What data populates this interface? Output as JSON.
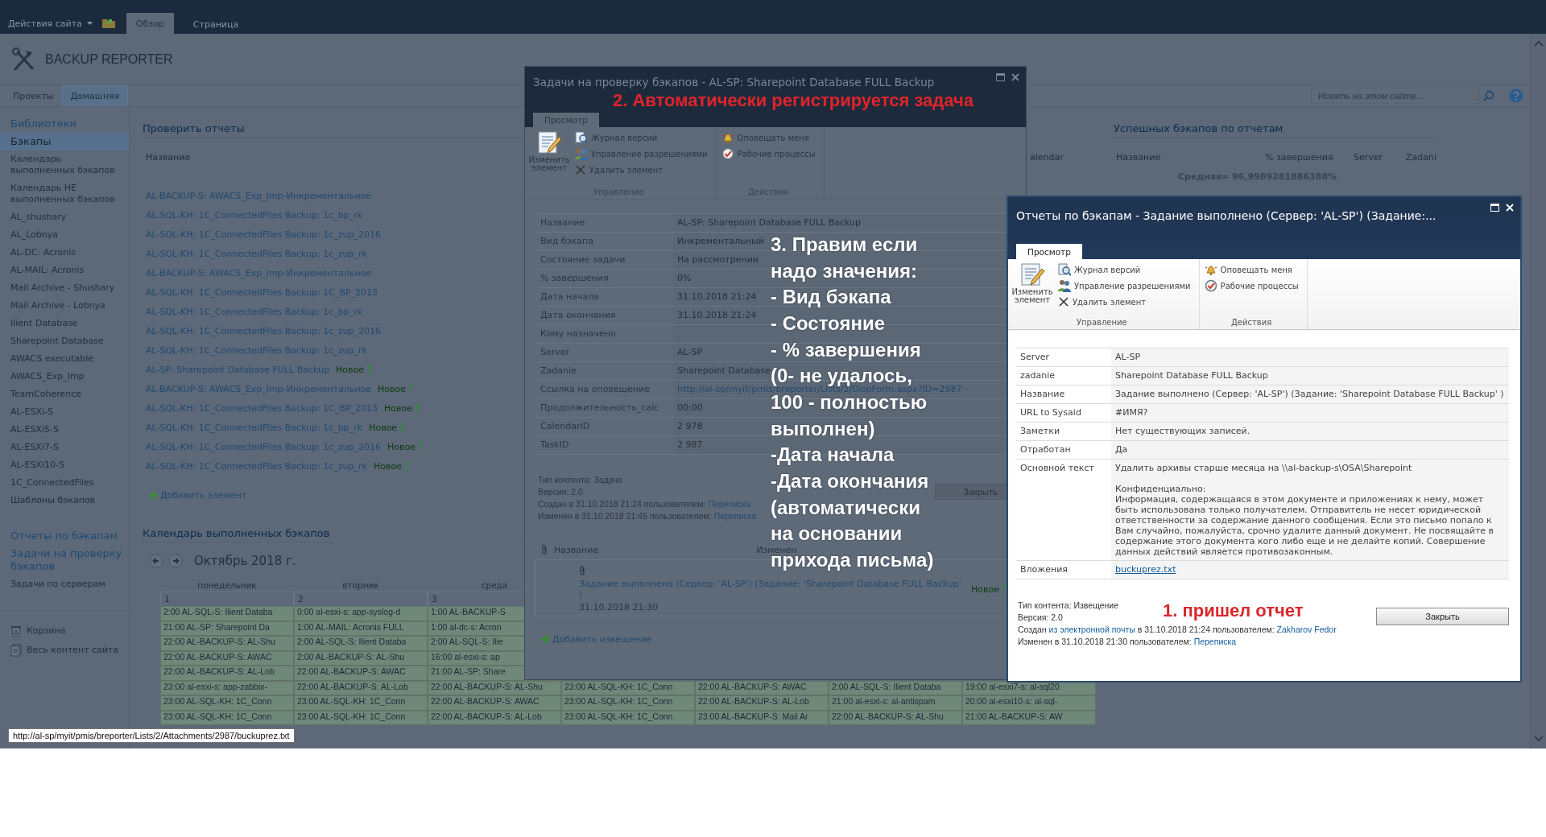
{
  "top_bar": {
    "site_actions": "Действия сайта",
    "tabs": [
      {
        "label": "Обзор",
        "selected": true
      },
      {
        "label": "Страница",
        "selected": false
      }
    ]
  },
  "site": {
    "title": "BACKUP REPORTER"
  },
  "nav": {
    "tabs": [
      {
        "label": "Проекты",
        "selected": false
      },
      {
        "label": "Домашняя",
        "selected": true
      }
    ],
    "search": {
      "placeholder": "Искать на этом сайте..."
    }
  },
  "sidebar": {
    "groups": [
      {
        "items": [
          {
            "label": "Библиотеки",
            "kind": "heading",
            "selected": false
          },
          {
            "label": "Бэкапы",
            "kind": "heading",
            "selected": true
          },
          {
            "label": "Календарь выполненных бэкапов",
            "kind": "link",
            "selected": false
          },
          {
            "label": "Календарь НЕ выполненных бэкапов",
            "kind": "link",
            "selected": false
          },
          {
            "label": "AL_shushary",
            "kind": "link",
            "selected": false
          },
          {
            "label": "AL_Lobnya",
            "kind": "link",
            "selected": false
          },
          {
            "label": "AL-DC: Acronis",
            "kind": "link",
            "selected": false
          },
          {
            "label": "AL-MAIL: Acronis",
            "kind": "link",
            "selected": false
          },
          {
            "label": "Mail Archive - Shushary",
            "kind": "link",
            "selected": false
          },
          {
            "label": "Mail Archive - Lobnya",
            "kind": "link",
            "selected": false
          },
          {
            "label": "Ilient Database",
            "kind": "link",
            "selected": false
          },
          {
            "label": "Sharepoint Database",
            "kind": "link",
            "selected": false
          },
          {
            "label": "AWACS executable",
            "kind": "link",
            "selected": false
          },
          {
            "label": "AWACS_Exp_Imp",
            "kind": "link",
            "selected": false
          },
          {
            "label": "TeamCoherence",
            "kind": "link",
            "selected": false
          },
          {
            "label": "AL-ESXi-S",
            "kind": "link",
            "selected": false
          },
          {
            "label": "AL-ESXi5-S",
            "kind": "link",
            "selected": false
          },
          {
            "label": "AL-ESXi7-S",
            "kind": "link",
            "selected": false
          },
          {
            "label": "AL-ESXi10-S",
            "kind": "link",
            "selected": false
          },
          {
            "label": "1C_ConnectedFiles",
            "kind": "link",
            "selected": false
          },
          {
            "label": "Шаблоны бэкапов",
            "kind": "link",
            "selected": false
          }
        ]
      },
      {
        "items": [
          {
            "label": "Отчеты по бэкапам",
            "kind": "heading",
            "selected": false
          },
          {
            "label": "Задачи на проверку бэкапов",
            "kind": "heading",
            "selected": false
          },
          {
            "label": "Задачи по серверам",
            "kind": "link",
            "selected": false
          }
        ]
      },
      {
        "items": [
          {
            "label": "Корзина",
            "kind": "trash",
            "selected": false
          },
          {
            "label": "Весь контент сайта",
            "kind": "pages",
            "selected": false
          }
        ]
      }
    ]
  },
  "check_reports": {
    "title": "Проверить отчеты",
    "column": "Название",
    "rows": [
      {
        "text": "AL-BACKUP-S: AWACS_Exp_Imp-Инкрементальное"
      },
      {
        "text": "AL-SQL-KH: 1C_ConnectedFiles Backup: 1c_bp_rk"
      },
      {
        "text": "AL-SQL-KH: 1C_ConnectedFiles Backup: 1c_zup_2016"
      },
      {
        "text": "AL-SQL-KH: 1C_ConnectedFiles Backup: 1c_zup_rk"
      },
      {
        "text": "AL-BACKUP-S: AWACS_Exp_Imp-Инкрементальное"
      },
      {
        "text": "AL-SQL-KH: 1C_ConnectedFiles Backup: 1C_BP_2013"
      },
      {
        "text": "AL-SQL-KH: 1C_ConnectedFiles Backup: 1c_bp_rk"
      },
      {
        "text": "AL-SQL-KH: 1C_ConnectedFiles Backup: 1c_zup_2016"
      },
      {
        "text": "AL-SQL-KH: 1C_ConnectedFiles Backup: 1c_zup_rk"
      },
      {
        "text": "AL-SP: Sharepoint Database FULL Backup",
        "badge": "Новое"
      },
      {
        "text": "AL-BACKUP-S: AWACS_Exp_Imp-Инкрементальное",
        "badge": "Новое"
      },
      {
        "text": "AL-SQL-KH: 1C_ConnectedFiles Backup: 1C_BP_2013",
        "badge": "Новое"
      },
      {
        "text": "AL-SQL-KH: 1C_ConnectedFiles Backup: 1c_bp_rk",
        "badge": "Новое"
      },
      {
        "text": "AL-SQL-KH: 1C_ConnectedFiles Backup: 1c_zup_2016",
        "badge": "Новое"
      },
      {
        "text": "AL-SQL-KH: 1C_ConnectedFiles Backup: 1c_zup_rk",
        "badge": "Новое"
      }
    ],
    "add": "Добавить элемент"
  },
  "success_reports": {
    "title": "Успешных бэкапов по отчетам",
    "columns": [
      "alendar",
      "Название",
      "% завершения",
      "Server",
      "Zadani"
    ],
    "average": "Средняя= 96,9989281886388%"
  },
  "calendar": {
    "title": "Календарь выполненных бэкапов",
    "month": "Октябрь 2018 г.",
    "weekdays": [
      "понедельник",
      "вторник",
      "среда"
    ],
    "days": [
      "1",
      "2",
      "3"
    ],
    "rows": [
      [
        "2:00 AL-SQL-S: Ilient Databa",
        "0:00 al-esxi-s: app-syslog-d",
        "1:00 AL-BACKUP-S"
      ],
      [
        "21:00 AL-SP: Sharepoint Da",
        "1:00 AL-MAIL: Acronis FULL",
        "1:00 al-dc-s: Acron"
      ],
      [
        "22:00 AL-BACKUP-S: AL-Shu",
        "2:00 AL-SQL-S: Ilient Databa",
        "2:00 AL-SQL-S: Ilie"
      ],
      [
        "22:00 AL-BACKUP-S: AWAC",
        "2:00 AL-BACKUP-S: AL-Shu",
        "16:00 al-esxi-s: ap"
      ],
      [
        "22:00 AL-BACKUP-S: AL-Lob",
        "22:00 AL-BACKUP-S: AWAC",
        "21:00 AL-SP: Share"
      ],
      [
        "23:00 al-esxi-s: app-zabbix-",
        "22:00 AL-BACKUP-S: AL-Lob",
        "22:00 AL-BACKUP-S: AL-Shu",
        "23:00 AL-SQL-KH: 1C_Conn",
        "22:00 AL-BACKUP-S: AWAC",
        "2:00 AL-SQL-S: Ilient Databa",
        "19:00 al-esxi7-s: al-sql20"
      ],
      [
        "23:00 AL-SQL-KH: 1C_Conn",
        "23:00 AL-SQL-KH: 1C_Conn",
        "22:00 AL-BACKUP-S: AWAC",
        "23:00 AL-SQL-KH: 1C_Conn",
        "22:00 AL-BACKUP-S: AL-Lob",
        "21:00 al-esxi-s: al-antispam",
        "20:00 al-esxi10-s: al-sql-"
      ],
      [
        "23:00 AL-SQL-KH: 1C_Conn",
        "23:00 AL-SQL-KH: 1C_Conn",
        "22:00 AL-BACKUP-S: AL-Lob",
        "23:00 AL-SQL-KH: 1C_Conn",
        "23:00 AL-BACKUP-S: Mail Ar",
        "22:00 AL-BACKUP-S: AL-Shu",
        "21:00 AL-BACKUP-S: AW"
      ]
    ]
  },
  "task_dialog": {
    "dimmed": true,
    "title": "Задачи на проверку бэкапов - AL-SP: Sharepoint Database FULL Backup",
    "header_note": "2. Автоматически регистрируется задача",
    "ribbon": {
      "tabs": [
        {
          "label": "Просмотр",
          "selected": true
        }
      ],
      "edit": "Изменить элемент",
      "groups": [
        {
          "label": "Управление",
          "items": [
            {
              "label": "Журнал версий",
              "kind": "history"
            },
            {
              "label": "Управление разрешениями",
              "kind": "permissions"
            },
            {
              "label": "Удалить элемент",
              "kind": "delete"
            }
          ]
        },
        {
          "label": "Действия",
          "items": [
            {
              "label": "Оповещать меня",
              "kind": "alert"
            },
            {
              "label": "Рабочие процессы",
              "kind": "workflow"
            }
          ]
        }
      ]
    },
    "fields": [
      {
        "label": "Название",
        "value": "AL-SP: Sharepoint Database FULL Backup",
        "kind": "text"
      },
      {
        "label": "Вид бэкапа",
        "value": "Инкрементальный",
        "kind": "text"
      },
      {
        "label": "Состояние задачи",
        "value": "На рассмотрении",
        "kind": "text"
      },
      {
        "label": "% завершения",
        "value": "0%",
        "kind": "text"
      },
      {
        "label": "Дата начала",
        "value": "31.10.2018 21:24",
        "kind": "text"
      },
      {
        "label": "Дата окончания",
        "value": "31.10.2018 21:24",
        "kind": "text"
      },
      {
        "label": "Кому назначено",
        "kind": "text"
      },
      {
        "label": "Server",
        "value": "AL-SP",
        "kind": "text"
      },
      {
        "label": "Zadanie",
        "value": "Sharepoint Database",
        "kind": "text"
      },
      {
        "label": "Ссылка на оповещение",
        "value": "http://al-sp/myit/pmis/breporter/Lists/2/DispForm.aspx?ID=2987",
        "kind": "link"
      },
      {
        "label": "Продолжительность_calc",
        "value": "00:00",
        "kind": "text"
      },
      {
        "label": "CalendarID",
        "value": "2 978",
        "kind": "text"
      },
      {
        "label": "TaskID",
        "value": "2 987",
        "kind": "text"
      }
    ],
    "meta": [
      [
        {
          "text": "Тип контента: Задача"
        }
      ],
      [
        {
          "text": "Версия: 2.0"
        }
      ],
      [
        {
          "text": "Создан в 31.10.2018 21:24 пользователем: "
        },
        {
          "link": "Переписка"
        }
      ],
      [
        {
          "text": "Изменен в 31.10.2018 21:45 пользователем: "
        },
        {
          "link": "Переписка"
        }
      ]
    ],
    "close": "Закрыть",
    "attachments": {
      "columns": [
        "Название",
        "Изменен"
      ],
      "items": [
        {
          "title": "Задание выполнено (Сервер: 'AL-SP') (Задание: 'Sharepoint Database FULL Backup' )",
          "badge": "Новое",
          "date": "31.10.2018 21:30"
        }
      ]
    },
    "add": "Добавить извещение",
    "overlay_note": [
      "3. Правим если",
      "надо значения:",
      "- Вид бэкапа",
      "- Состояние",
      "- % завершения",
      "(0- не удалось,",
      "100 - полностью",
      "выполнен)",
      "-Дата начала",
      "-Дата окончания",
      "(автоматически",
      "на основании",
      "прихода письма)"
    ]
  },
  "report_dialog": {
    "dimmed": false,
    "title": "Отчеты по бэкапам - Задание выполнено (Сервер: 'AL-SP') (Задание:...",
    "ribbon": {
      "tabs": [
        {
          "label": "Просмотр",
          "selected": true
        }
      ],
      "edit": "Изменить элемент",
      "groups": [
        {
          "label": "Управление",
          "items": [
            {
              "label": "Журнал версий",
              "kind": "history"
            },
            {
              "label": "Управление разрешениями",
              "kind": "permissions"
            },
            {
              "label": "Удалить элемент",
              "kind": "delete"
            }
          ]
        },
        {
          "label": "Действия",
          "items": [
            {
              "label": "Оповещать меня",
              "kind": "alert"
            },
            {
              "label": "Рабочие процессы",
              "kind": "workflow"
            }
          ]
        }
      ]
    },
    "fields": [
      {
        "label": "Server",
        "value": "AL-SP",
        "kind": "text"
      },
      {
        "label": "zadanie",
        "value": "Sharepoint Database FULL Backup",
        "kind": "text"
      },
      {
        "label": "Название",
        "value": "Задание выполнено (Сервер: 'AL-SP') (Задание: 'Sharepoint Database FULL Backup' )",
        "kind": "text"
      },
      {
        "label": "URL to Sysaid",
        "value": "#ИМЯ?",
        "kind": "text"
      },
      {
        "label": "Заметки",
        "value": "Нет существующих записей.",
        "kind": "text"
      },
      {
        "label": "Отработан",
        "value": "Да",
        "kind": "text"
      },
      {
        "label": "Основной текст",
        "value": "Удалить архивы старше месяца на \\\\al-backup-s\\OSA\\Sharepoint\n\nКонфиденциально:\nИнформация, содержащаяся в этом документе и приложениях к нему, может быть использована только получателем. Отправитель не несет юридической ответственности за содержание данного сообщения. Если это письмо попало к Вам случайно, пожалуйста, срочно удалите данный документ. Не посвящайте в содержание этого документа кого либо еще и не делайте копий. Совершение данных действий является противозаконным.",
        "kind": "text"
      },
      {
        "label": "Вложения",
        "value": "buckuprez.txt",
        "kind": "link"
      }
    ],
    "meta": [
      [
        {
          "text": "Тип контента: Извещение"
        }
      ],
      [
        {
          "text": "Версия: 2.0"
        }
      ],
      [
        {
          "text": "Создан "
        },
        {
          "link": "из электронной почты"
        },
        {
          "text": " в 31.10.2018 21:24 пользователем: "
        },
        {
          "link": "Zakharov Fedor"
        }
      ],
      [
        {
          "text": "Изменен в 31.10.2018 21:30 пользователем: "
        },
        {
          "link": "Переписка"
        }
      ]
    ],
    "close": "Закрыть",
    "footer_note": "1. пришел отчет"
  },
  "status_bar": {
    "url": "http://al-sp/myit/pmis/breporter/Lists/2/Attachments/2987/buckuprez.txt"
  }
}
